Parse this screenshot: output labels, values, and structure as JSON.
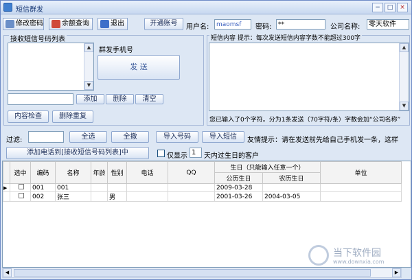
{
  "window": {
    "title": "短信群发",
    "min": "−",
    "max": "□",
    "close": "×"
  },
  "toolbar": {
    "change_pwd": "修改密码",
    "balance": "余额查询",
    "exit": "退出"
  },
  "account": {
    "open_btn": "开通账号",
    "user_label": "用户名:",
    "user_value": "maomsf",
    "pwd_label": "密码:",
    "pwd_value": "**",
    "company_label": "公司名称:",
    "company_value": "零天软件"
  },
  "recv": {
    "group_label": "接收短信号码列表",
    "send_phone_label": "群发手机号",
    "send_btn": "发 送",
    "add_btn": "添加",
    "del_btn": "删除",
    "clear_btn": "清空",
    "check_btn": "内容检查",
    "dedup_btn": "删除重复"
  },
  "content": {
    "label": "短信内容  提示：每次发送短信内容字数不能超过300字",
    "status": "您已输入了0个字符。分为1条发送（70字符/条）字数会加“公司名称”"
  },
  "filter": {
    "label": "过滤:",
    "select_all": "全选",
    "deselect_all": "全撤",
    "import_num": "导入号码",
    "import_sms": "导入短信",
    "tip": "友情提示：请在发送前先给自己手机发一条，这样"
  },
  "birthday": {
    "add_btn": "添加电话到[接收短信号码列表]中",
    "only_show": "仅显示",
    "days": "1",
    "suffix": "天内过生日的客户"
  },
  "table": {
    "headers": {
      "sel": "选中",
      "code": "编码",
      "name": "名称",
      "age": "年龄",
      "gender": "性别",
      "phone": "电话",
      "qq": "QQ",
      "birthday": "生日（只能输入任意一个）",
      "solar": "公历生日",
      "lunar": "农历生日",
      "unit": "单位"
    },
    "rows": [
      {
        "code": "001",
        "name": "001",
        "age": "",
        "gender": "",
        "phone": "",
        "qq": "",
        "solar": "2009-03-28",
        "lunar": "",
        "unit": ""
      },
      {
        "code": "002",
        "name": "张三",
        "age": "",
        "gender": "男",
        "phone": "",
        "qq": "",
        "solar": "2001-03-26",
        "lunar": "2004-03-05",
        "unit": ""
      }
    ]
  },
  "watermark": {
    "name": "当下软件园",
    "url": "www.downxia.com"
  }
}
